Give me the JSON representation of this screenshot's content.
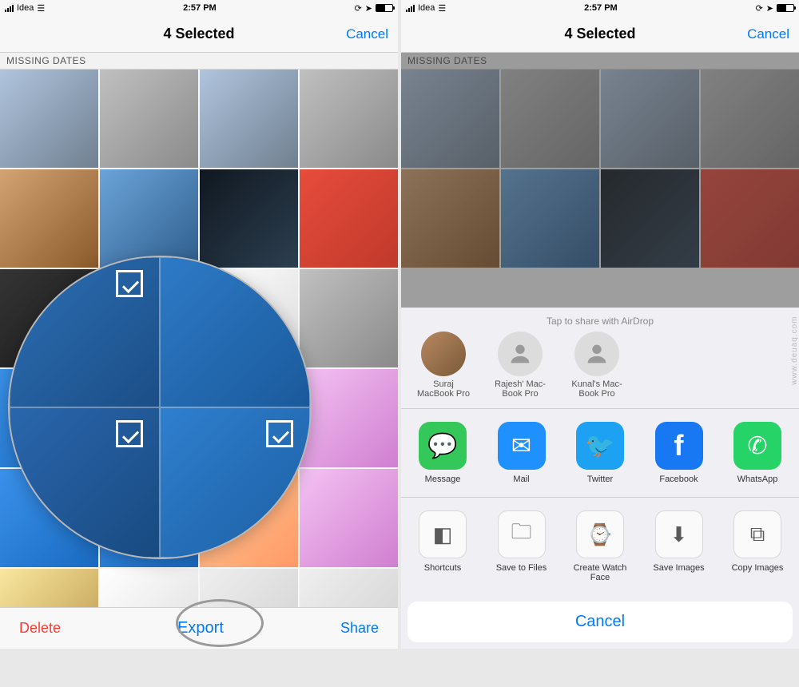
{
  "status": {
    "carrier": "Idea",
    "time": "2:57 PM"
  },
  "left": {
    "nav_title": "4 Selected",
    "nav_cancel": "Cancel",
    "section_header": "MISSING DATES",
    "toolbar": {
      "delete": "Delete",
      "export": "Export",
      "share": "Share"
    }
  },
  "right": {
    "nav_title": "4 Selected",
    "nav_cancel": "Cancel",
    "section_header": "MISSING DATES",
    "sheet": {
      "airdrop_header": "Tap to share with AirDrop",
      "airdrop": [
        {
          "name": "Suraj",
          "device": "MacBook Pro"
        },
        {
          "name": "Rajesh' Mac-",
          "device": "Book Pro"
        },
        {
          "name": "Kunal's Mac-",
          "device": "Book Pro"
        }
      ],
      "apps": [
        {
          "id": "message",
          "label": "Message"
        },
        {
          "id": "mail",
          "label": "Mail"
        },
        {
          "id": "twitter",
          "label": "Twitter"
        },
        {
          "id": "facebook",
          "label": "Facebook"
        },
        {
          "id": "whatsapp",
          "label": "WhatsApp"
        }
      ],
      "actions": [
        {
          "id": "shortcuts",
          "label": "Shortcuts"
        },
        {
          "id": "save-to-files",
          "label": "Save to Files"
        },
        {
          "id": "create-watch-face",
          "label": "Create Watch Face"
        },
        {
          "id": "save-images",
          "label": "Save Images"
        },
        {
          "id": "copy-images",
          "label": "Copy Images"
        }
      ],
      "cancel": "Cancel"
    }
  },
  "watermark": "www.deuaq.com"
}
